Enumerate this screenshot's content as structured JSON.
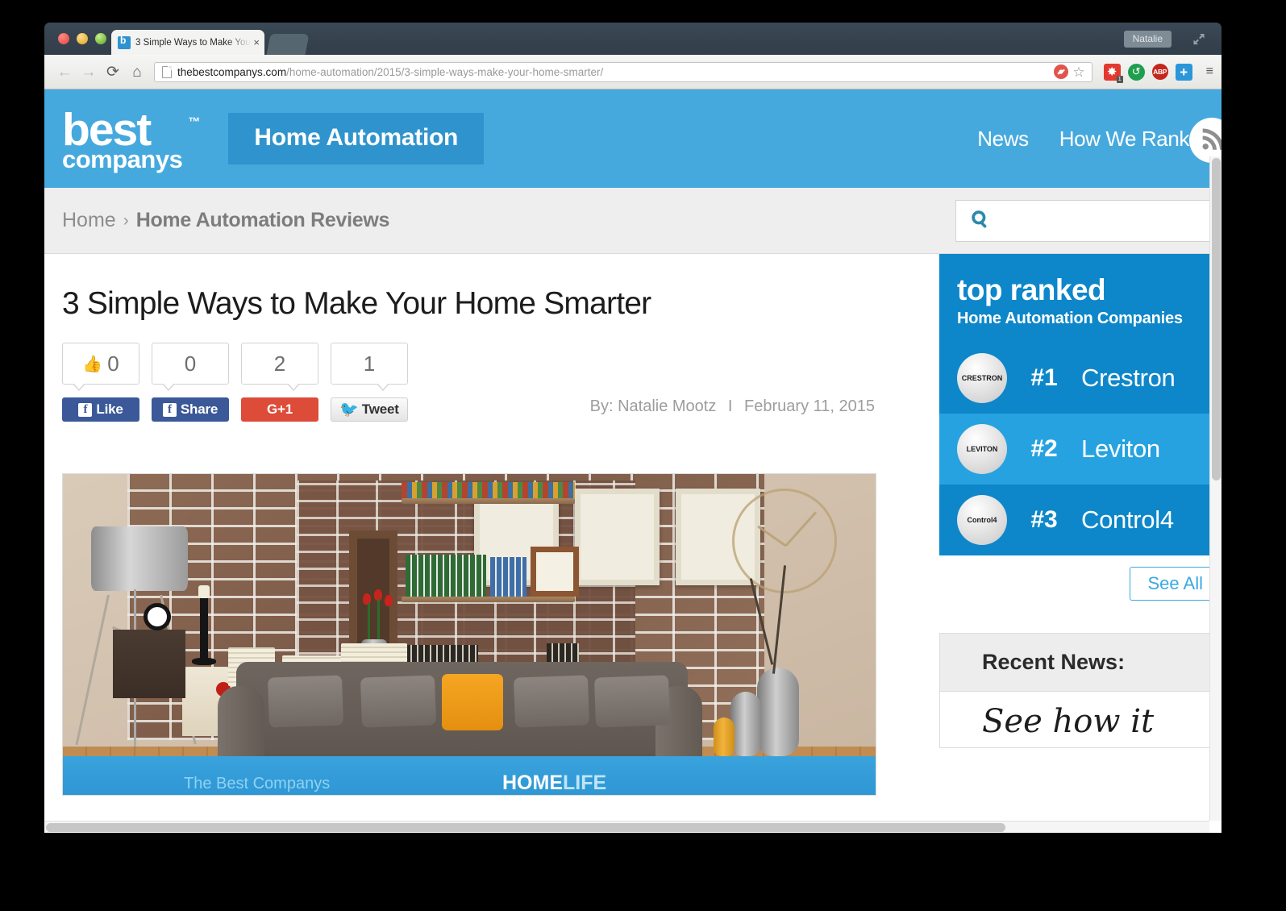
{
  "window": {
    "user_chip": "Natalie",
    "expand_icon": "expand-icon"
  },
  "tab": {
    "title": "3 Simple Ways to Make You",
    "close": "×",
    "favicon": "bestcompanys-favicon"
  },
  "toolbar": {
    "back": "←",
    "forward": "→",
    "reload": "⟳",
    "home": "⌂",
    "url_domain": "thebestcompanys.com",
    "url_path": "/home-automation/2015/3-simple-ways-make-your-home-smarter/",
    "bookmark_star": "☆",
    "extensions": [
      {
        "name": "blocker-extension-icon",
        "glyph": "",
        "badge": ""
      },
      {
        "name": "red-puzzle-extension-icon",
        "glyph": "✸",
        "badge": "1"
      },
      {
        "name": "green-sync-extension-icon",
        "glyph": "↺",
        "badge": ""
      },
      {
        "name": "adblock-plus-extension-icon",
        "glyph": "ABP",
        "badge": ""
      },
      {
        "name": "blue-plus-extension-icon",
        "glyph": "+",
        "badge": ""
      }
    ],
    "menu": "≡"
  },
  "site": {
    "logo": {
      "word1": "best",
      "tm": "™",
      "word2": "companys"
    },
    "section_pill": "Home Automation",
    "nav": [
      {
        "label": "News"
      },
      {
        "label": "How We Rank"
      }
    ],
    "rss_icon": "rss-icon"
  },
  "breadcrumb": {
    "home": "Home",
    "separator": "›",
    "current": "Home Automation Reviews"
  },
  "search": {
    "icon": "search-icon",
    "value": "",
    "placeholder": ""
  },
  "article": {
    "title": "3 Simple Ways to Make Your Home Smarter",
    "author_label": "By: Natalie Mootz",
    "separator": "I",
    "date": "February 11, 2015",
    "hero_alt": "living-room-brick-wall-sofa"
  },
  "social": [
    {
      "name": "facebook-like",
      "count": "0",
      "button": "Like",
      "icon": "thumbs-up-icon",
      "kind": "fb"
    },
    {
      "name": "facebook-share",
      "count": "0",
      "button": "Share",
      "icon": "facebook-f-icon",
      "kind": "fb"
    },
    {
      "name": "google-plus-one",
      "count": "2",
      "button": "G+1",
      "icon": "google-plus-icon",
      "kind": "g"
    },
    {
      "name": "twitter-tweet",
      "count": "1",
      "button": "Tweet",
      "icon": "twitter-bird-icon",
      "kind": "tw"
    }
  ],
  "hero_banner": {
    "left_text": "The Best Companys",
    "right_bold": "HOME",
    "right_light": "LIFE"
  },
  "top_ranked": {
    "title": "top ranked",
    "subtitle": "Home Automation Companies",
    "rows": [
      {
        "rank": "#1",
        "name": "Crestron",
        "logo_text": "CRESTRON"
      },
      {
        "rank": "#2",
        "name": "Leviton",
        "logo_text": "LEVITON"
      },
      {
        "rank": "#3",
        "name": "Control4",
        "logo_text": "Control4"
      }
    ],
    "see_all": "See All"
  },
  "recent_news": {
    "heading": "Recent News:",
    "teaser": "See how it"
  },
  "colors": {
    "header_blue": "#46a9de",
    "pill_blue": "#2f94cd",
    "card_blue": "#0d87c9",
    "card_blue_alt": "#27a2e0",
    "link_blue": "#3aa9e2",
    "facebook": "#3b5998",
    "google": "#dd4b39",
    "twitter": "#2daae1",
    "breadcrumb_bg": "#eeeeee",
    "chrome_titlebar": "#364450"
  }
}
